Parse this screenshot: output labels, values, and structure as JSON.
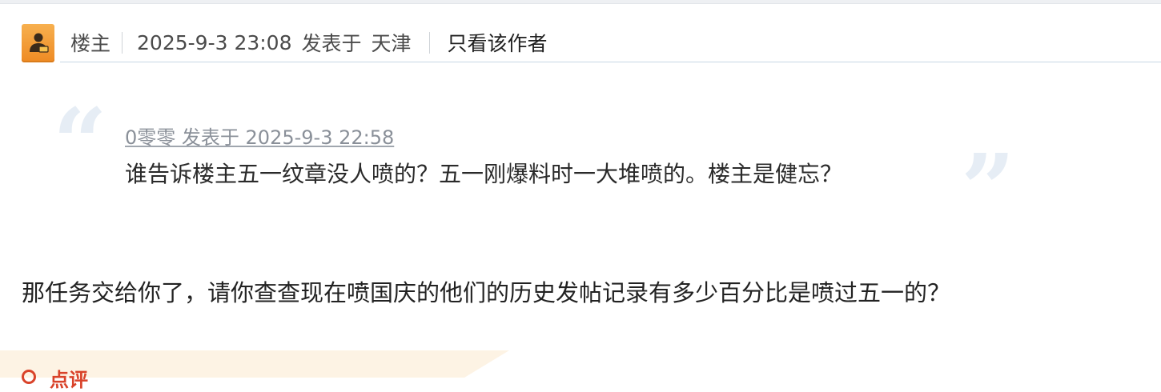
{
  "post_header": {
    "role_label": "楼主",
    "timestamp": "2025-9-3 23:08",
    "posted_at_label": "发表于",
    "location": "天津",
    "only_author_label": "只看该作者"
  },
  "quote": {
    "citation": "0零零 发表于 2025-9-3 22:58",
    "text": "谁告诉楼主五一纹章没人喷的？五一刚爆料时一大堆喷的。楼主是健忘？"
  },
  "body": {
    "text": "那任务交给你了，请你查查现在喷国庆的他们的历史发帖记录有多少百分比是喷过五一的？"
  },
  "rating": {
    "label": "点评"
  },
  "colors": {
    "badge_orange": "#ee8a23",
    "rating_red": "#d9432a",
    "quote_mark": "#e6edf5",
    "rating_bg": "#fdf3e4"
  },
  "icons": {
    "op_badge": "user-badge-icon",
    "open_quote": "open-quote-icon",
    "close_quote": "close-quote-icon",
    "rating": "rating-circle-icon"
  }
}
